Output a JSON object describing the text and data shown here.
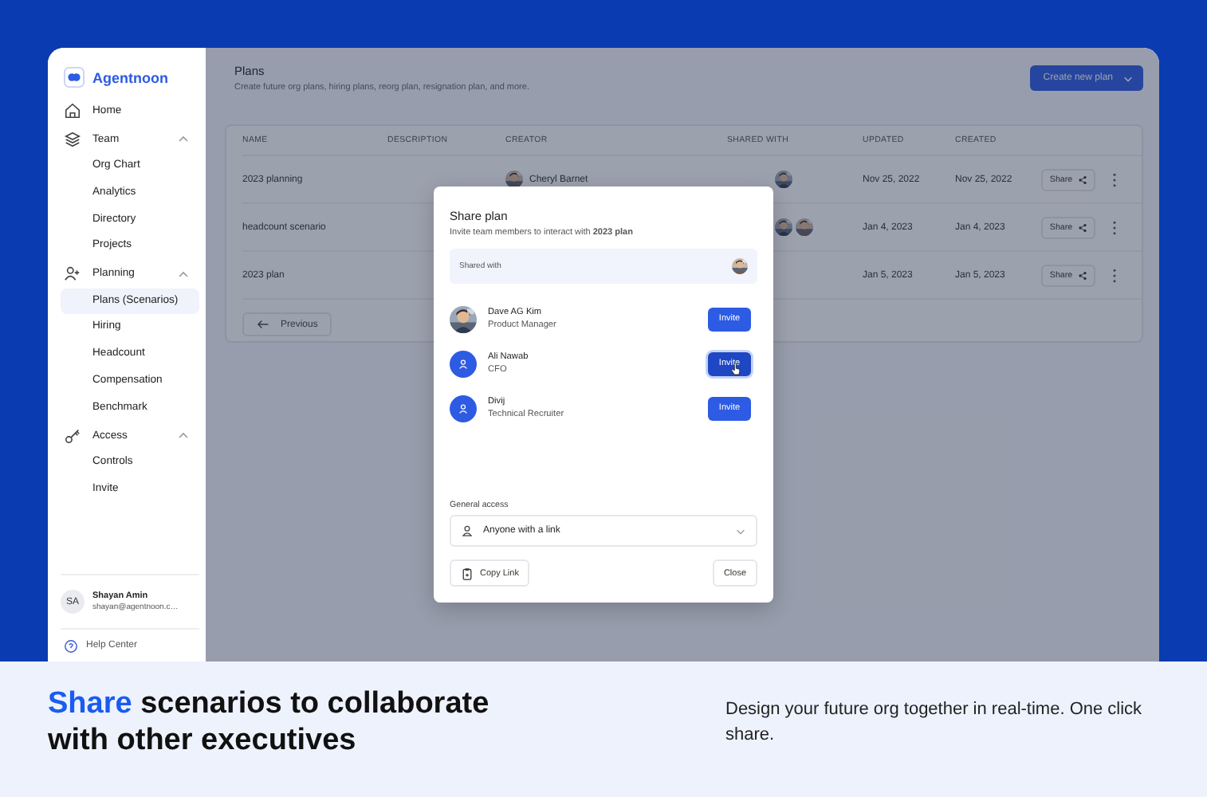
{
  "sidebar": {
    "brand": "Agentnoon",
    "items": [
      {
        "label": "Home"
      },
      {
        "label": "Team",
        "expanded": true,
        "children": [
          {
            "label": "Org Chart",
            "selected": false
          },
          {
            "label": "Analytics",
            "selected": false
          },
          {
            "label": "Directory",
            "selected": false
          },
          {
            "label": "Projects",
            "selected": false
          }
        ]
      },
      {
        "label": "Planning",
        "expanded": true,
        "children": [
          {
            "label": "Plans (Scenarios)",
            "selected": true
          },
          {
            "label": "Hiring",
            "selected": false
          },
          {
            "label": "Headcount",
            "selected": false
          },
          {
            "label": "Compensation",
            "selected": false
          },
          {
            "label": "Benchmark",
            "selected": false
          }
        ]
      },
      {
        "label": "Access",
        "expanded": true,
        "children": [
          {
            "label": "Controls",
            "selected": false
          },
          {
            "label": "Invite",
            "selected": false
          }
        ]
      }
    ],
    "user": {
      "initials": "SA",
      "name": "Shayan Amin",
      "email": "shayan@agentnoon.c…"
    },
    "help": "Help Center"
  },
  "page": {
    "title": "Plans",
    "subtitle": "Create future org plans, hiring plans, reorg plan, resignation plan, and more.",
    "create_button": "Create new plan"
  },
  "table": {
    "columns": [
      "NAME",
      "DESCRIPTION",
      "CREATOR",
      "SHARED WITH",
      "UPDATED",
      "CREATED"
    ],
    "rows": [
      {
        "name": "2023 planning",
        "creator": "Cheryl Barnet",
        "updated": "Nov 25, 2022",
        "created": "Nov 25, 2022",
        "share": "Share"
      },
      {
        "name": "headcount scenario",
        "updated": "Jan 4, 2023",
        "created": "Jan 4, 2023",
        "share": "Share"
      },
      {
        "name": "2023 plan",
        "shared_with": [],
        "updated": "Jan 5, 2023",
        "created": "Jan 5, 2023",
        "share": "Share"
      }
    ],
    "previous": "Previous"
  },
  "modal": {
    "title": "Share plan",
    "subtitle": "Invite team members to interact with **2023 plan**",
    "shared_with_label": "Shared with",
    "members": [
      {
        "name": "Dave AG Kim",
        "role": "Product Manager",
        "button": "Invite",
        "hovered": false
      },
      {
        "name": "Ali Nawab",
        "role": "CFO",
        "kind": "placeholder",
        "button": "Invite",
        "hovered": true
      },
      {
        "name": "Divij",
        "role": "Technical Recruiter",
        "kind": "placeholder",
        "button": "Invite",
        "hovered": false
      }
    ],
    "access_label": "General access",
    "access_value": "Anyone with a link",
    "copy_button": "Copy Link",
    "close_button": "Close"
  },
  "banner": {
    "highlight": "Share",
    "headline": "scenarios to collaborate with other executives",
    "description": "Design your future org together in real-time. One click share."
  }
}
